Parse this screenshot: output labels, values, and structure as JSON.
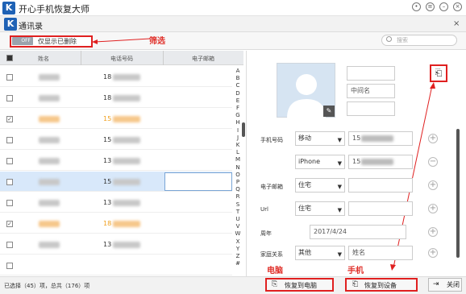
{
  "app": {
    "title": "开心手机恢复大师",
    "logo_letter": "K",
    "window_title": "通讯录"
  },
  "filter": {
    "switch_label": "OFF",
    "label": "仅显示已删除",
    "annotation": "筛选"
  },
  "search": {
    "placeholder": "搜索"
  },
  "table": {
    "columns": [
      "姓名",
      "电话号码",
      "电子邮箱"
    ],
    "rows": [
      {
        "phone": "18",
        "checked": false,
        "deleted": false,
        "selected": false
      },
      {
        "phone": "18",
        "checked": false,
        "deleted": false,
        "selected": false
      },
      {
        "phone": "15",
        "checked": true,
        "deleted": true,
        "selected": false
      },
      {
        "phone": "15",
        "checked": false,
        "deleted": false,
        "selected": false
      },
      {
        "phone": "13",
        "checked": false,
        "deleted": false,
        "selected": false
      },
      {
        "phone": "15",
        "checked": false,
        "deleted": false,
        "selected": true
      },
      {
        "phone": "13",
        "checked": false,
        "deleted": false,
        "selected": false
      },
      {
        "phone": "18",
        "checked": true,
        "deleted": true,
        "selected": false
      },
      {
        "phone": "13",
        "checked": false,
        "deleted": false,
        "selected": false
      },
      {
        "phone": "",
        "checked": false,
        "deleted": false,
        "selected": false
      }
    ]
  },
  "alphabet": [
    "A",
    "B",
    "C",
    "D",
    "E",
    "F",
    "G",
    "H",
    "I",
    "J",
    "K",
    "L",
    "M",
    "N",
    "O",
    "P",
    "Q",
    "R",
    "S",
    "T",
    "U",
    "V",
    "W",
    "X",
    "Y",
    "Z",
    "#"
  ],
  "detail": {
    "middle_name_placeholder": "中间名",
    "phone_label": "手机号码",
    "phone_type_1": "移动",
    "phone_value_1": "15",
    "phone_type_2": "iPhone",
    "phone_value_2": "15",
    "email_label": "电子邮箱",
    "email_type": "住宅",
    "url_label": "Url",
    "url_type": "住宅",
    "anniversary_label": "周年",
    "anniversary_value": "2017/4/24",
    "relation_label": "家庭关系",
    "relation_type": "其他",
    "relation_placeholder": "姓名"
  },
  "status": {
    "text": "已选择（45）项，总共（176）项"
  },
  "buttons": {
    "restore_pc": "恢复到电脑",
    "restore_device": "恢复到设备",
    "close": "关闭"
  },
  "annotations": {
    "pc": "电脑",
    "phone": "手机"
  },
  "colors": {
    "accent": "#1f62b5",
    "annotation": "#e02020",
    "deleted": "#f0a020",
    "selected_row": "#d8e8fa"
  }
}
